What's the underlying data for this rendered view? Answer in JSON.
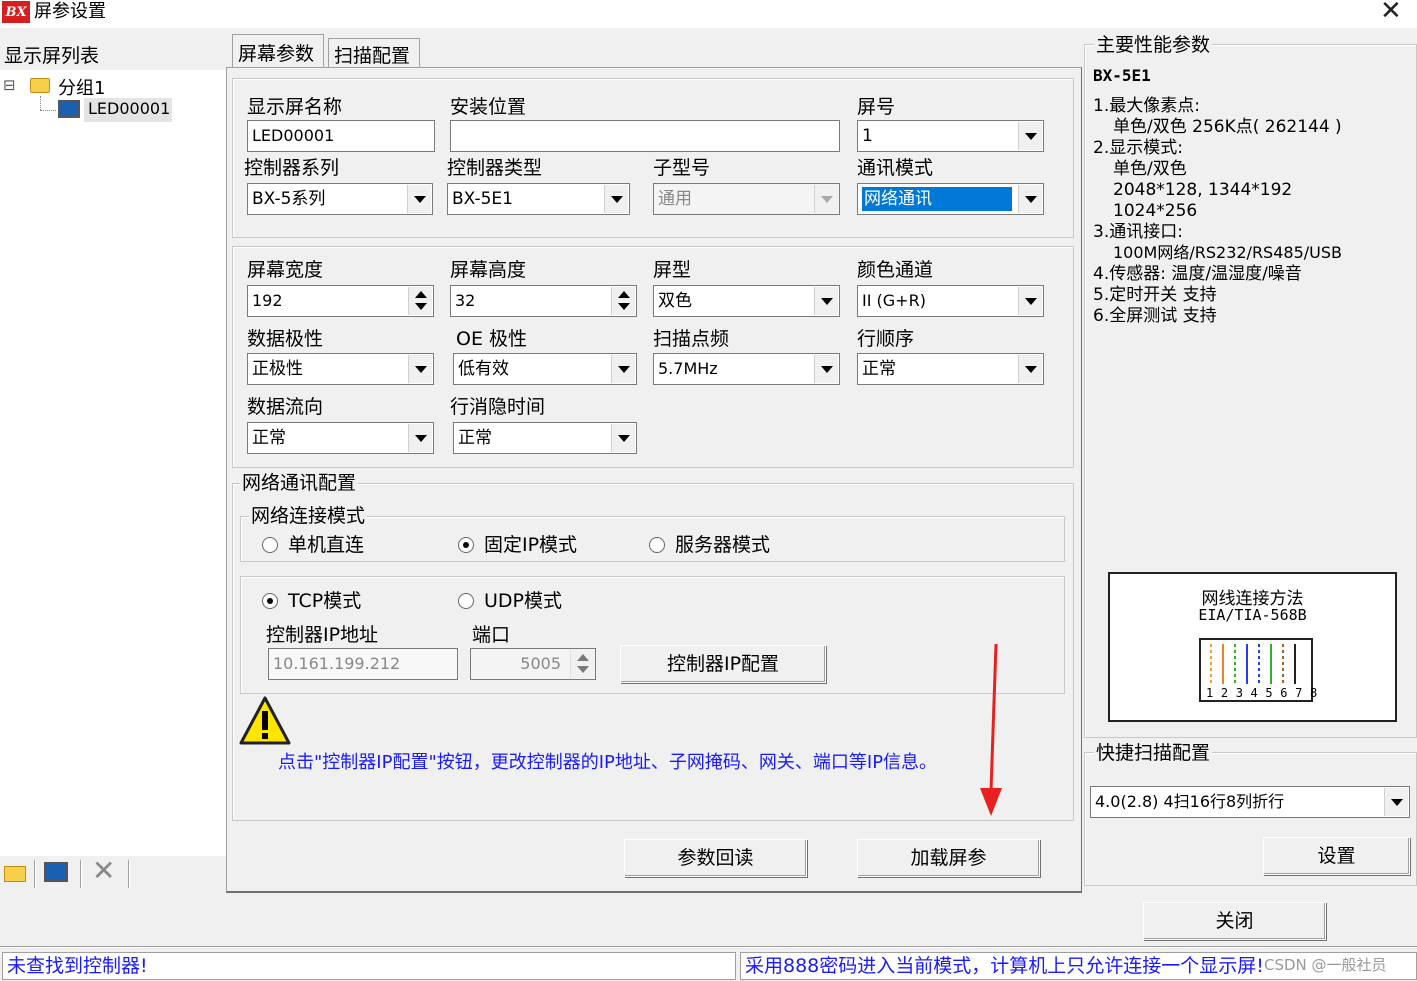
{
  "window": {
    "logo": "BX",
    "title": "屏参设置"
  },
  "left": {
    "header": "显示屏列表",
    "tree_toggle": "⊟",
    "group_name": "分组1",
    "screen_name": "LED00001"
  },
  "tabs": [
    {
      "label": "屏幕参数"
    },
    {
      "label": "扫描配置"
    }
  ],
  "basic": {
    "name_label": "显示屏名称",
    "name_value": "LED00001",
    "location_label": "安装位置",
    "location_value": "",
    "screen_no_label": "屏号",
    "screen_no_value": "1",
    "series_label": "控制器系列",
    "series_value": "BX-5系列",
    "type_label": "控制器类型",
    "type_value": "BX-5E1",
    "submodel_label": "子型号",
    "submodel_value": "通用",
    "comm_label": "通讯模式",
    "comm_value": "网络通讯"
  },
  "display": {
    "width_label": "屏幕宽度",
    "width_value": "192",
    "height_label": "屏幕高度",
    "height_value": "32",
    "screen_type_label": "屏型",
    "screen_type_value": "双色",
    "color_label": "颜色通道",
    "color_value": "II (G+R)",
    "polarity_label": "数据极性",
    "polarity_value": "正极性",
    "oe_label": "OE 极性",
    "oe_value": "低有效",
    "scan_freq_label": "扫描点频",
    "scan_freq_value": "5.7MHz",
    "row_order_label": "行顺序",
    "row_order_value": "正常",
    "flow_label": "数据流向",
    "flow_value": "正常",
    "blanking_label": "行消隐时间",
    "blanking_value": "正常"
  },
  "network": {
    "group_title": "网络通讯配置",
    "mode_title": "网络连接模式",
    "mode_options": [
      "单机直连",
      "固定IP模式",
      "服务器模式"
    ],
    "mode_selected": "固定IP模式",
    "proto_options": [
      "TCP模式",
      "UDP模式"
    ],
    "proto_selected": "TCP模式",
    "ip_label": "控制器IP地址",
    "ip_value": "10.161.199.212",
    "port_label": "端口",
    "port_value": "5005",
    "ip_config_button": "控制器IP配置",
    "warning_text": "点击\"控制器IP配置\"按钮，更改控制器的IP地址、子网掩码、网关、端口等IP信息。"
  },
  "buttons": {
    "readback": "参数回读",
    "load": "加载屏参",
    "settings": "设置",
    "close": "关闭"
  },
  "perf": {
    "title": "主要性能参数",
    "model": "BX-5E1",
    "lines": [
      "1.最大像素点:",
      "单色/双色 256K点( 262144 )",
      "2.显示模式:",
      "单色/双色",
      "2048*128, 1344*192",
      "1024*256",
      "3.通讯接口:",
      "100M网络/RS232/RS485/USB",
      "4.传感器: 温度/温湿度/噪音",
      "5.定时开关 支持",
      "6.全屏测试 支持"
    ],
    "cable_title": "网线连接方法",
    "cable_std": "EIA/TIA-568B",
    "cable_pins": "1 2 3 4 5 6 7 8"
  },
  "quick_scan": {
    "title": "快捷扫描配置",
    "value": "4.0(2.8) 4扫16行8列折行"
  },
  "status": {
    "left": "未查找到控制器!",
    "right": "采用888密码进入当前模式，计算机上只允许连接一个显示屏!",
    "watermark": "CSDN @一般社员"
  },
  "colors": {
    "accent_blue": "#1a1aff",
    "selection": "#0078d7",
    "arrow_red": "#e8201e",
    "warning_yellow": "#ffe600"
  }
}
